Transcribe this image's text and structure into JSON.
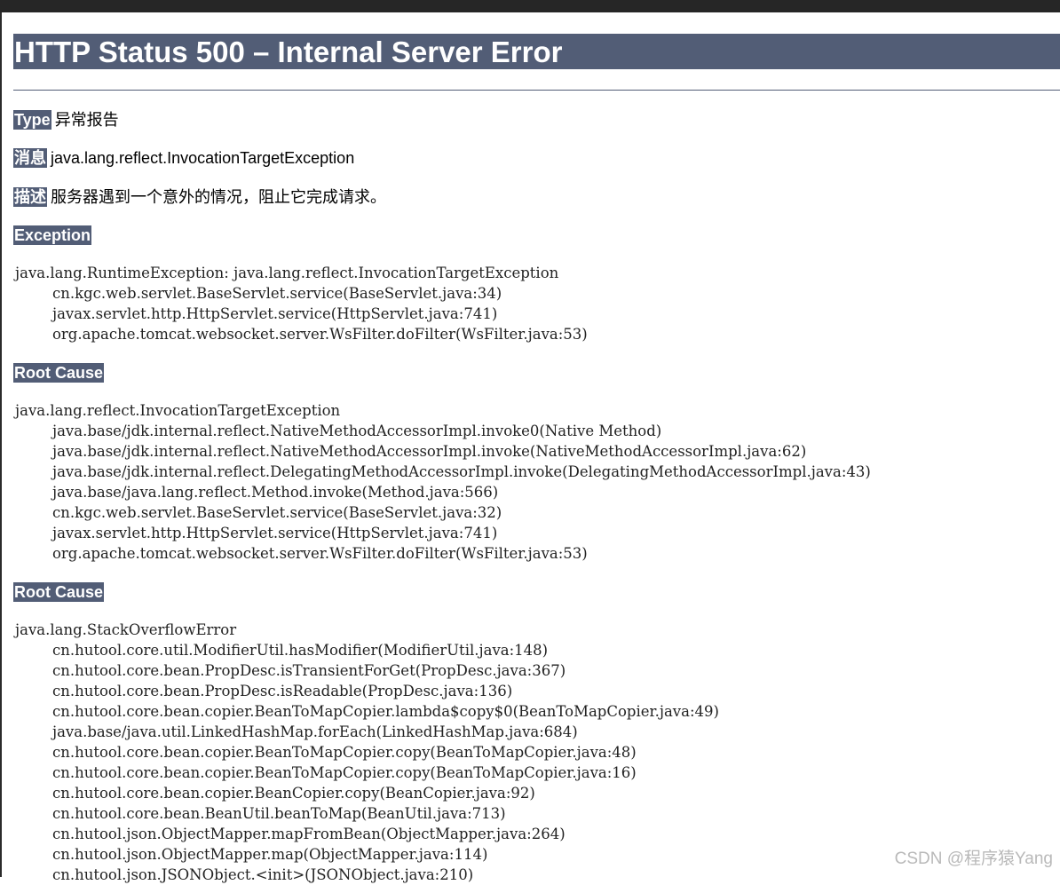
{
  "heading": "HTTP Status 500 – Internal Server Error",
  "type_label": "Type",
  "type_value": "异常报告",
  "message_label": "消息",
  "message_value": "java.lang.reflect.InvocationTargetException",
  "description_label": "描述",
  "description_value": "服务器遇到一个意外的情况，阻止它完成请求。",
  "exception_label": "Exception",
  "exception_trace": [
    "java.lang.RuntimeException: java.lang.reflect.InvocationTargetException",
    "        cn.kgc.web.servlet.BaseServlet.service(BaseServlet.java:34)",
    "        javax.servlet.http.HttpServlet.service(HttpServlet.java:741)",
    "        org.apache.tomcat.websocket.server.WsFilter.doFilter(WsFilter.java:53)"
  ],
  "root_cause_label_1": "Root Cause",
  "root_cause_trace_1": [
    "java.lang.reflect.InvocationTargetException",
    "        java.base/jdk.internal.reflect.NativeMethodAccessorImpl.invoke0(Native Method)",
    "        java.base/jdk.internal.reflect.NativeMethodAccessorImpl.invoke(NativeMethodAccessorImpl.java:62)",
    "        java.base/jdk.internal.reflect.DelegatingMethodAccessorImpl.invoke(DelegatingMethodAccessorImpl.java:43)",
    "        java.base/java.lang.reflect.Method.invoke(Method.java:566)",
    "        cn.kgc.web.servlet.BaseServlet.service(BaseServlet.java:32)",
    "        javax.servlet.http.HttpServlet.service(HttpServlet.java:741)",
    "        org.apache.tomcat.websocket.server.WsFilter.doFilter(WsFilter.java:53)"
  ],
  "root_cause_label_2": "Root Cause",
  "root_cause_trace_2": [
    "java.lang.StackOverflowError",
    "        cn.hutool.core.util.ModifierUtil.hasModifier(ModifierUtil.java:148)",
    "        cn.hutool.core.bean.PropDesc.isTransientForGet(PropDesc.java:367)",
    "        cn.hutool.core.bean.PropDesc.isReadable(PropDesc.java:136)",
    "        cn.hutool.core.bean.copier.BeanToMapCopier.lambda$copy$0(BeanToMapCopier.java:49)",
    "        java.base/java.util.LinkedHashMap.forEach(LinkedHashMap.java:684)",
    "        cn.hutool.core.bean.copier.BeanToMapCopier.copy(BeanToMapCopier.java:48)",
    "        cn.hutool.core.bean.copier.BeanToMapCopier.copy(BeanToMapCopier.java:16)",
    "        cn.hutool.core.bean.copier.BeanCopier.copy(BeanCopier.java:92)",
    "        cn.hutool.core.bean.BeanUtil.beanToMap(BeanUtil.java:713)",
    "        cn.hutool.json.ObjectMapper.mapFromBean(ObjectMapper.java:264)",
    "        cn.hutool.json.ObjectMapper.map(ObjectMapper.java:114)",
    "        cn.hutool.json.JSONObject.<init>(JSONObject.java:210)"
  ],
  "watermark": "CSDN @程序猿Yang",
  "colors": {
    "header_bg": "#525d76",
    "header_text": "#ffffff"
  }
}
